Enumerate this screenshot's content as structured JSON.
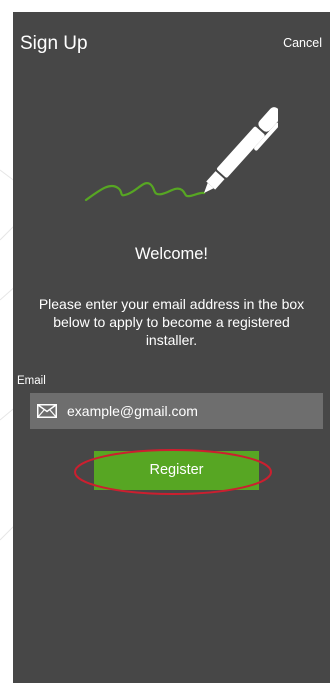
{
  "header": {
    "title": "Sign Up",
    "cancel_label": "Cancel"
  },
  "illustration": {
    "icon": "pen-signature-icon",
    "stroke_color": "#57a623"
  },
  "welcome": {
    "heading": "Welcome!",
    "instructions": "Please enter your email address in the box below to apply to become a registered installer."
  },
  "form": {
    "email_label": "Email",
    "email_placeholder": "example@gmail.com",
    "email_value": "",
    "email_icon": "mail-icon",
    "register_label": "Register"
  },
  "colors": {
    "screen_bg": "#474747",
    "field_bg": "#6e6e6e",
    "accent_green": "#57a623",
    "highlight_red": "#cc1f2f"
  }
}
